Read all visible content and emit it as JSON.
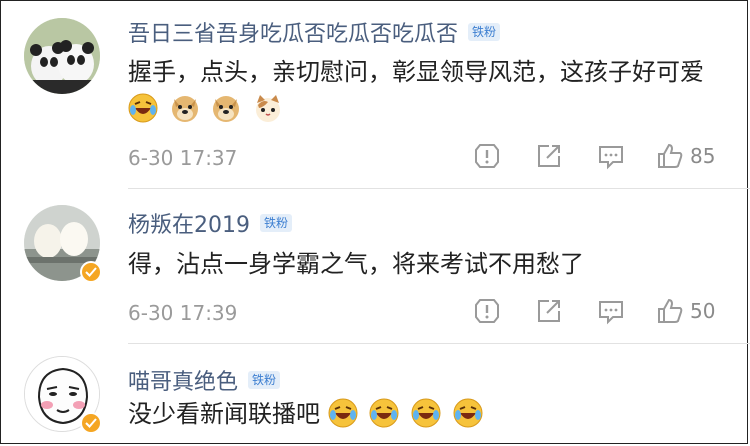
{
  "comments": [
    {
      "username": "吾日三省吾身吃瓜否吃瓜否吃瓜否",
      "badge": "铁粉",
      "text": "握手，点头，亲切慰问，彰显领导风范，这孩子好可爱",
      "emojis": [
        "laugh-cry-emoji",
        "doge-emoji",
        "doge-emoji",
        "cat-emoji"
      ],
      "time": "6-30 17:37",
      "likes": "85"
    },
    {
      "username": "杨叛在2019",
      "badge": "铁粉",
      "text": "得，沾点一身学霸之气，将来考试不用愁了",
      "emojis": [],
      "time": "6-30 17:39",
      "likes": "50"
    },
    {
      "username": "喵哥真绝色",
      "badge": "铁粉",
      "text": "没少看新闻联播吧",
      "emojis": [
        "laugh-cry-emoji",
        "laugh-cry-emoji",
        "laugh-cry-emoji",
        "laugh-cry-emoji"
      ]
    }
  ],
  "colors": {
    "username": "#4a5e7e",
    "badge_bg": "#e4eef9",
    "badge_text": "#3d7fd1",
    "vip": "#f5a623"
  }
}
